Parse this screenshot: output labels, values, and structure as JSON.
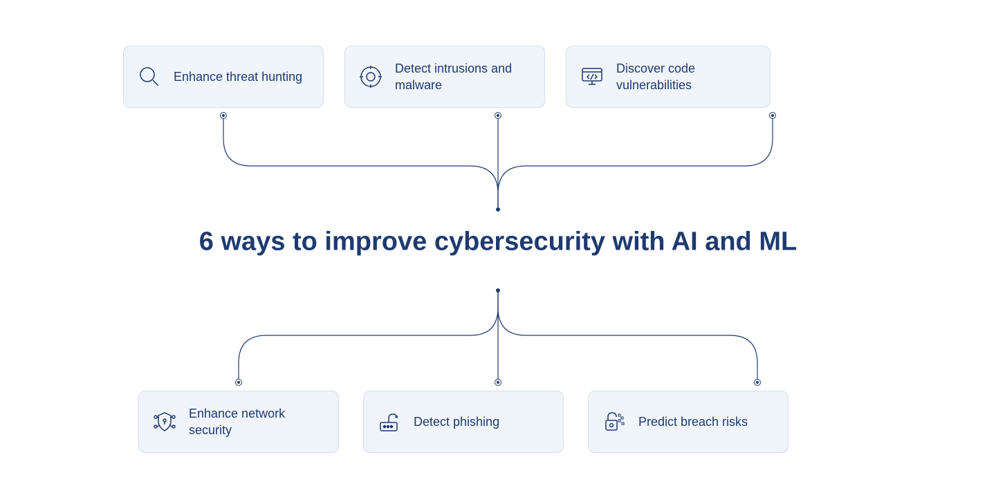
{
  "title": "6 ways to improve cybersecurity with AI and ML",
  "top_cards": [
    {
      "label": "Enhance threat hunting",
      "icon": "magnifier-icon"
    },
    {
      "label": "Detect intrusions and malware",
      "icon": "target-bug-icon"
    },
    {
      "label": "Discover code vulnerabilities",
      "icon": "code-monitor-icon"
    }
  ],
  "bottom_cards": [
    {
      "label": "Enhance network security",
      "icon": "shield-network-icon"
    },
    {
      "label": "Detect phishing",
      "icon": "phishing-icon"
    },
    {
      "label": "Predict breach risks",
      "icon": "unlock-risk-icon"
    }
  ],
  "colors": {
    "primary": "#1e3a6f",
    "card_bg": "#f0f4fb",
    "card_border": "#d6dde9"
  }
}
